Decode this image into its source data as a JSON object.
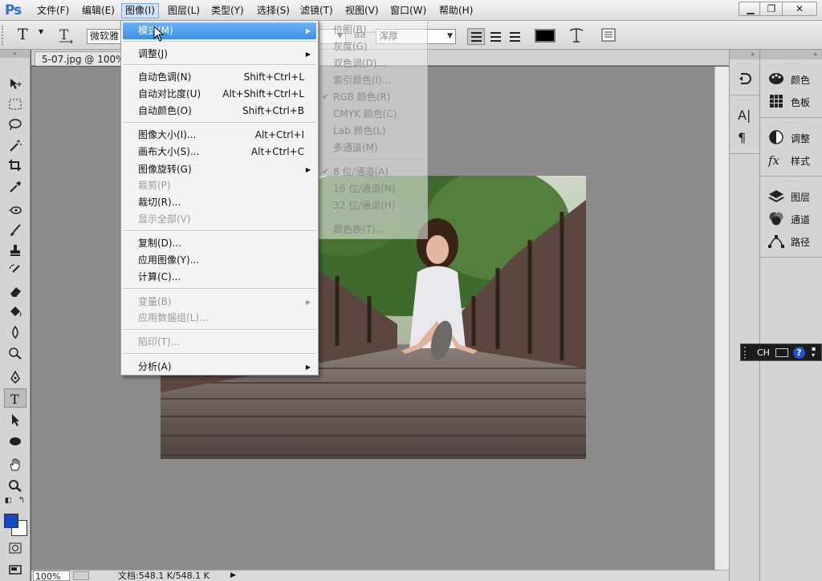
{
  "app": {
    "logo": "Ps"
  },
  "menubar": {
    "items": [
      "文件(F)",
      "编辑(E)",
      "图像(I)",
      "图层(L)",
      "类型(Y)",
      "选择(S)",
      "滤镜(T)",
      "视图(V)",
      "窗口(W)",
      "帮助(H)"
    ],
    "active": "图像(I)"
  },
  "window_controls": {
    "minimize": "▁",
    "restore": "❐",
    "close": "✕"
  },
  "options": {
    "tool_glyph": "T",
    "font_family": "微软雅",
    "antialias_icon": "aa",
    "antialias_value": "浑厚",
    "text_color": "#000000"
  },
  "document": {
    "tab_title": "5-07.jpg @ 100%("
  },
  "status": {
    "zoom": "100%",
    "doc_info": "文档:548.1 K/548.1 K"
  },
  "image_menu": {
    "items": [
      {
        "label": "模式(M)",
        "shortcut": "",
        "submenu": true,
        "state": "highlighted"
      },
      {
        "label": "调整(J)",
        "shortcut": "",
        "submenu": true,
        "state": "normal"
      },
      {
        "label": "自动色调(N)",
        "shortcut": "Shift+Ctrl+L",
        "submenu": false,
        "state": "normal"
      },
      {
        "label": "自动对比度(U)",
        "shortcut": "Alt+Shift+Ctrl+L",
        "submenu": false,
        "state": "normal"
      },
      {
        "label": "自动颜色(O)",
        "shortcut": "Shift+Ctrl+B",
        "submenu": false,
        "state": "normal"
      },
      {
        "label": "图像大小(I)...",
        "shortcut": "Alt+Ctrl+I",
        "submenu": false,
        "state": "normal"
      },
      {
        "label": "画布大小(S)...",
        "shortcut": "Alt+Ctrl+C",
        "submenu": false,
        "state": "normal"
      },
      {
        "label": "图像旋转(G)",
        "shortcut": "",
        "submenu": true,
        "state": "normal"
      },
      {
        "label": "裁剪(P)",
        "shortcut": "",
        "submenu": false,
        "state": "disabled"
      },
      {
        "label": "裁切(R)...",
        "shortcut": "",
        "submenu": false,
        "state": "normal"
      },
      {
        "label": "显示全部(V)",
        "shortcut": "",
        "submenu": false,
        "state": "disabled"
      },
      {
        "label": "复制(D)...",
        "shortcut": "",
        "submenu": false,
        "state": "normal"
      },
      {
        "label": "应用图像(Y)...",
        "shortcut": "",
        "submenu": false,
        "state": "normal"
      },
      {
        "label": "计算(C)...",
        "shortcut": "",
        "submenu": false,
        "state": "normal"
      },
      {
        "label": "变量(B)",
        "shortcut": "",
        "submenu": true,
        "state": "disabled"
      },
      {
        "label": "应用数据组(L)...",
        "shortcut": "",
        "submenu": false,
        "state": "disabled"
      },
      {
        "label": "陷印(T)...",
        "shortcut": "",
        "submenu": false,
        "state": "disabled"
      },
      {
        "label": "分析(A)",
        "shortcut": "",
        "submenu": true,
        "state": "normal"
      }
    ]
  },
  "mode_submenu": {
    "items": [
      {
        "label": "位图(B)...",
        "checked": false
      },
      {
        "label": "灰度(G)",
        "checked": false
      },
      {
        "label": "双色调(D)...",
        "checked": false
      },
      {
        "label": "索引颜色(I)...",
        "checked": false
      },
      {
        "label": "RGB 颜色(R)",
        "checked": true
      },
      {
        "label": "CMYK 颜色(C)",
        "checked": false
      },
      {
        "label": "Lab 颜色(L)",
        "checked": false
      },
      {
        "label": "多通道(M)",
        "checked": false
      },
      {
        "label": "8 位/通道(A)",
        "checked": true
      },
      {
        "label": "16 位/通道(N)",
        "checked": false
      },
      {
        "label": "32 位/通道(H)",
        "checked": false
      },
      {
        "label": "颜色表(T)...",
        "checked": false
      }
    ]
  },
  "panels": {
    "icon_column": [
      "history-icon",
      "character-icon",
      "paragraph-icon"
    ],
    "groups": [
      {
        "items": [
          {
            "label": "颜色",
            "icon": "palette-icon"
          },
          {
            "label": "色板",
            "icon": "swatches-icon"
          }
        ]
      },
      {
        "items": [
          {
            "label": "调整",
            "icon": "adjustments-icon"
          },
          {
            "label": "样式",
            "icon": "styles-icon"
          }
        ]
      },
      {
        "items": [
          {
            "label": "图层",
            "icon": "layers-icon"
          },
          {
            "label": "通道",
            "icon": "channels-icon"
          },
          {
            "label": "路径",
            "icon": "paths-icon"
          }
        ]
      }
    ]
  },
  "langbar": {
    "lang": "CH",
    "help": "?"
  },
  "colors": {
    "foreground": "#1548c7",
    "background": "#ffffff",
    "menu_highlight": "#3a8fe6"
  }
}
